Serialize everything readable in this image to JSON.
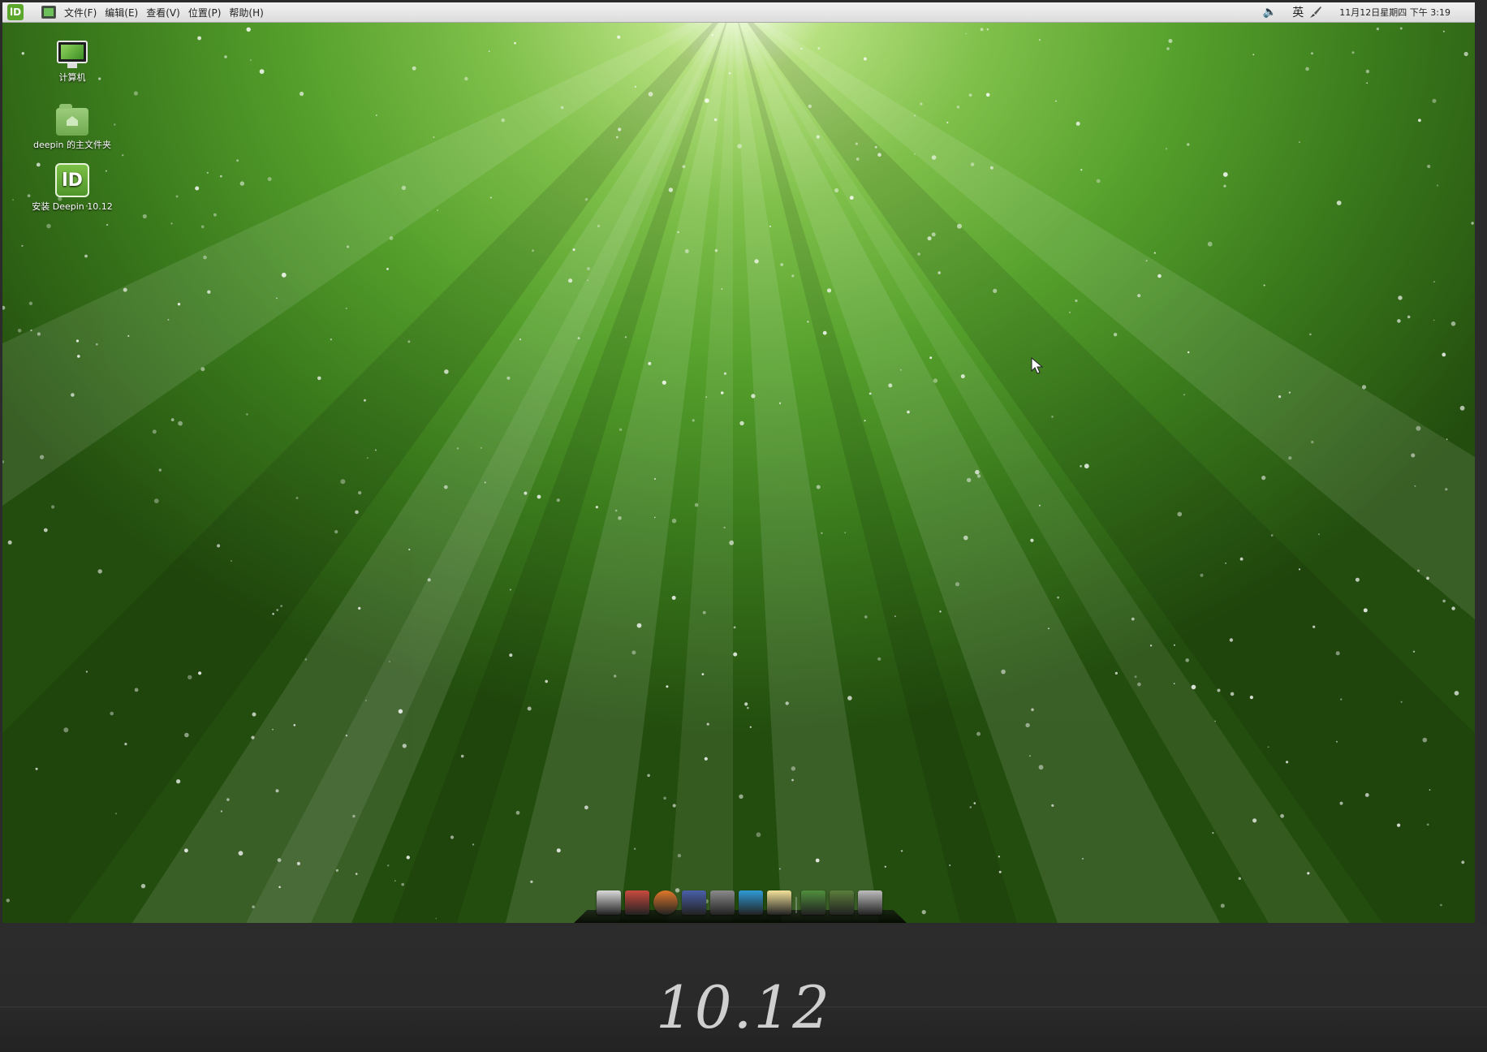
{
  "top_panel": {
    "menu_logo": "deepin-logo",
    "menus": [
      {
        "label": "文件(F)"
      },
      {
        "label": "编辑(E)"
      },
      {
        "label": "查看(V)"
      },
      {
        "label": "位置(P)"
      },
      {
        "label": "帮助(H)"
      }
    ],
    "input_method": "英",
    "clock": "11月12日星期四 下午 3:19"
  },
  "desktop_icons": [
    {
      "label": "计算机",
      "icon": "computer-icon"
    },
    {
      "label": "deepin 的主文件夹",
      "icon": "home-folder-icon"
    },
    {
      "label": "安装 Deepin 10.12",
      "icon": "deepin-installer-icon"
    }
  ],
  "dock": [
    {
      "icon": "file-manager-icon",
      "color": "#d9d9d9"
    },
    {
      "icon": "software-center-icon",
      "color": "#c94a3e"
    },
    {
      "icon": "firefox-icon",
      "color": "#e0782b"
    },
    {
      "icon": "screenshot-icon",
      "color": "#4a5fa8"
    },
    {
      "icon": "media-player-icon",
      "color": "#8a8a8a"
    },
    {
      "icon": "deepin-update-icon",
      "color": "#2f9ad6"
    },
    {
      "icon": "text-editor-icon",
      "color": "#f3e29a"
    },
    {
      "icon": "system-monitor-icon",
      "color": "#4f8f3c"
    },
    {
      "icon": "workspace-switcher-icon",
      "color": "#5b7d3a"
    },
    {
      "icon": "trash-icon",
      "color": "#bdbdbd"
    }
  ],
  "version_label": "10.12",
  "colors": {
    "wallpaper_light": "#f6ffe8",
    "wallpaper_mid": "#55a02c",
    "wallpaper_dark": "#234d0e",
    "panel_bg": "#e6e6e6",
    "stage_bg": "#2b2b2b"
  }
}
